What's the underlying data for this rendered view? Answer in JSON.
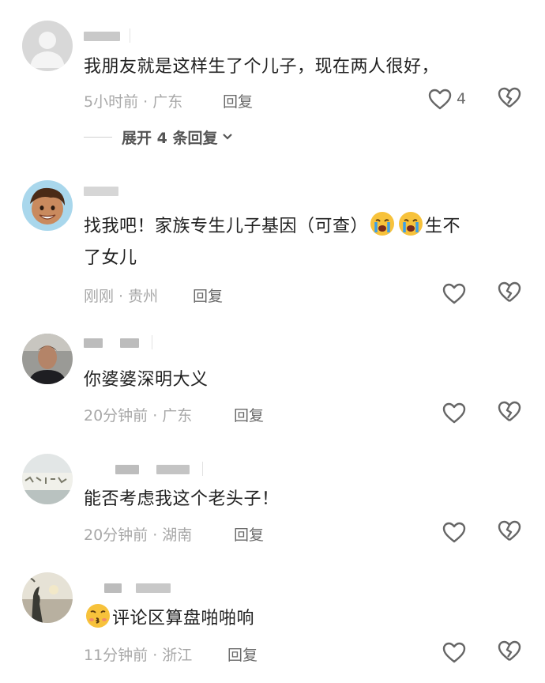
{
  "colors": {
    "text": "#1f1f1f",
    "meta": "#a8a8a8",
    "action": "#6a6a6a"
  },
  "comments": [
    {
      "text": "我朋友就是这样生了个儿子，现在两人很好，",
      "time_location": "5小时前 · 广东",
      "reply_label": "回复",
      "like_count": "4",
      "avatar": "default-avatar-icon"
    },
    {
      "text_before": "找我吧！家族专生儿子基因（可查）",
      "emojis": [
        "crying-face-icon",
        "crying-face-icon"
      ],
      "text_after": "生不",
      "text_line2": "了女儿",
      "time_location": "刚刚 · 贵州",
      "reply_label": "回复",
      "avatar": "cartoon-boy-avatar"
    },
    {
      "text": "你婆婆深明大义",
      "time_location": "20分钟前 · 广东",
      "reply_label": "回复",
      "avatar": "man-photo-avatar"
    },
    {
      "text": "能否考虑我这个老头子！",
      "time_location": "20分钟前 · 湖南",
      "reply_label": "回复",
      "avatar": "sign-photo-avatar"
    },
    {
      "emoji": "kissing-face-icon",
      "text": "评论区算盘啪啪响",
      "time_location": "11分钟前 · 浙江",
      "reply_label": "回复",
      "avatar": "sunset-silhouette-avatar"
    }
  ],
  "expand_replies": {
    "label": "展开 4 条回复",
    "icon": "chevron-down-icon"
  }
}
